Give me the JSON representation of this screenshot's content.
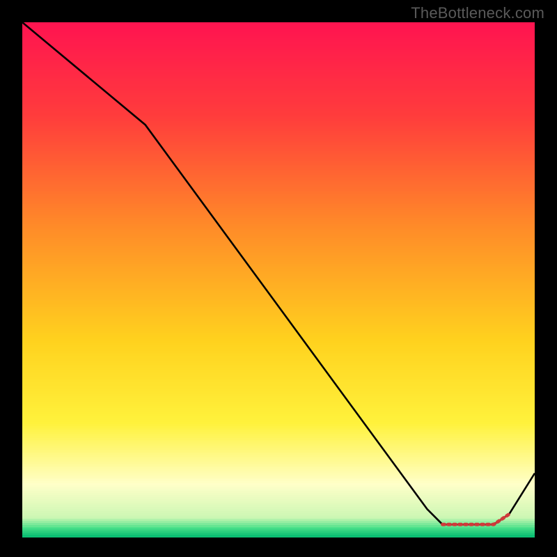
{
  "attribution": "TheBottleneck.com",
  "colors": {
    "frame": "#000000",
    "text": "#5a5a5a"
  },
  "chart_data": {
    "type": "line",
    "title": "",
    "xlabel": "",
    "ylabel": "",
    "x_range": [
      0,
      100
    ],
    "y_range": [
      0,
      100
    ],
    "gradient_stops": [
      {
        "pos": 0.0,
        "color": "#ff1450"
      },
      {
        "pos": 0.18,
        "color": "#ff3c3c"
      },
      {
        "pos": 0.4,
        "color": "#ff8c28"
      },
      {
        "pos": 0.62,
        "color": "#ffd21e"
      },
      {
        "pos": 0.78,
        "color": "#fff23c"
      },
      {
        "pos": 0.9,
        "color": "#ffffc8"
      },
      {
        "pos": 0.965,
        "color": "#ccf7b4"
      },
      {
        "pos": 0.985,
        "color": "#49e089"
      },
      {
        "pos": 1.0,
        "color": "#0cbf73"
      }
    ],
    "series": [
      {
        "name": "bottleneck-curve",
        "points": [
          {
            "x": 0,
            "y": 100
          },
          {
            "x": 24,
            "y": 80
          },
          {
            "x": 79,
            "y": 5
          },
          {
            "x": 82,
            "y": 2
          },
          {
            "x": 92,
            "y": 2
          },
          {
            "x": 95,
            "y": 4
          },
          {
            "x": 100,
            "y": 12
          }
        ]
      }
    ],
    "dotted_segment": {
      "from_index": 3,
      "to_index": 5
    },
    "dotted_color": "#d03a3a"
  }
}
